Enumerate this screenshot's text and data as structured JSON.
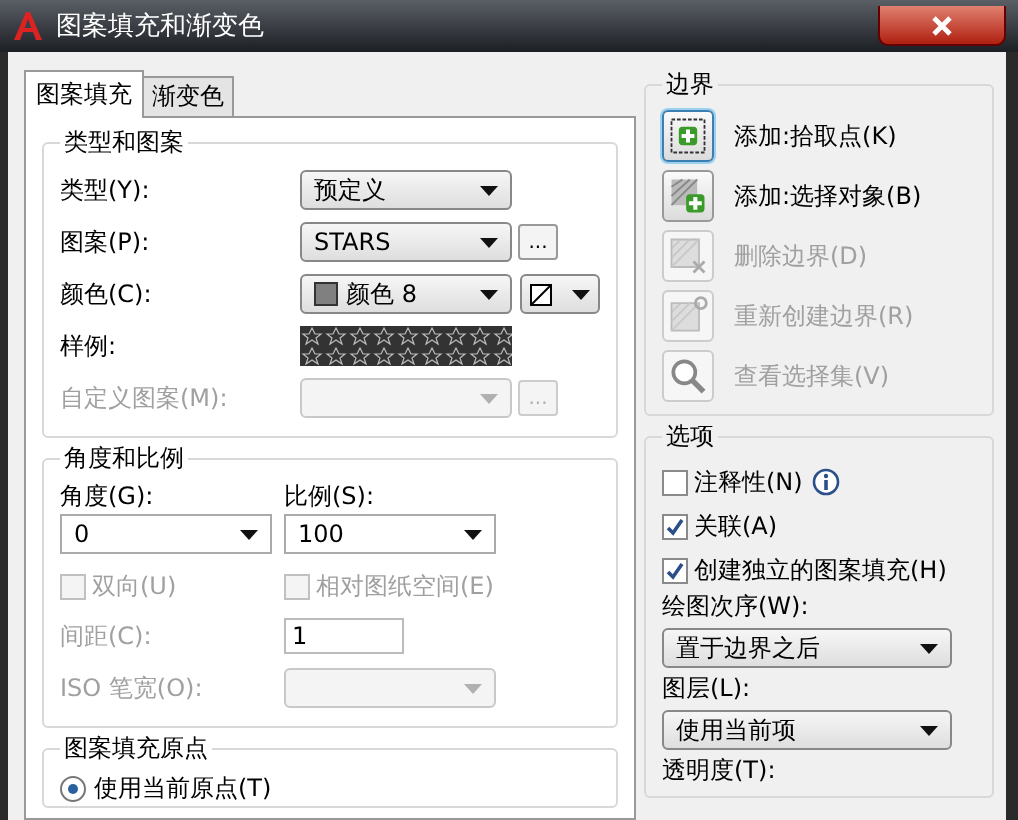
{
  "window": {
    "title": "图案填充和渐变色"
  },
  "tabs": [
    {
      "label": "图案填充",
      "selected": true
    },
    {
      "label": "渐变色",
      "selected": false
    }
  ],
  "type_and_pattern": {
    "title": "类型和图案",
    "type": {
      "label": "类型(Y):",
      "value": "预定义"
    },
    "pattern": {
      "label": "图案(P):",
      "value": "STARS",
      "browse": "..."
    },
    "color": {
      "label": "颜色(C):",
      "value": "颜色 8",
      "color": "#808080"
    },
    "sample": {
      "label": "样例:"
    },
    "custom_pattern": {
      "label": "自定义图案(M):",
      "disabled": true,
      "browse": "..."
    }
  },
  "angle_and_scale": {
    "title": "角度和比例",
    "angle": {
      "label": "角度(G):",
      "value": "0"
    },
    "scale": {
      "label": "比例(S):",
      "value": "100"
    },
    "checks": [
      {
        "label": "双向(U)",
        "checked": false,
        "disabled": true
      },
      {
        "label": "相对图纸空间(E)",
        "checked": false,
        "disabled": true
      }
    ],
    "spacing": {
      "label": "间距(C):",
      "value": "1",
      "disabled": true
    },
    "iso_pen_width": {
      "label": "ISO 笔宽(O):",
      "disabled": true
    }
  },
  "origin": {
    "title": "图案填充原点",
    "options": [
      {
        "label": "使用当前原点(T)",
        "selected": true
      }
    ]
  },
  "boundary": {
    "title": "边界",
    "actions": [
      {
        "kind": "pick",
        "label": "添加:拾取点(K)",
        "disabled": false,
        "focused": true
      },
      {
        "kind": "select",
        "label": "添加:选择对象(B)",
        "disabled": false,
        "focused": false
      },
      {
        "kind": "remove",
        "label": "删除边界(D)",
        "disabled": true,
        "focused": false
      },
      {
        "kind": "recreate",
        "label": "重新创建边界(R)",
        "disabled": true,
        "focused": false
      },
      {
        "kind": "view",
        "label": "查看选择集(V)",
        "disabled": true,
        "focused": false
      }
    ]
  },
  "options": {
    "title": "选项",
    "checks": [
      {
        "label": "注释性(N)",
        "checked": false,
        "info": true
      },
      {
        "label": "关联(A)",
        "checked": true
      },
      {
        "label": "创建独立的图案填充(H)",
        "checked": true
      }
    ],
    "draw_order": {
      "label": "绘图次序(W):",
      "value": "置于边界之后"
    },
    "layer": {
      "label": "图层(L):",
      "value": "使用当前项"
    },
    "transparency": {
      "label": "透明度(T):"
    }
  }
}
